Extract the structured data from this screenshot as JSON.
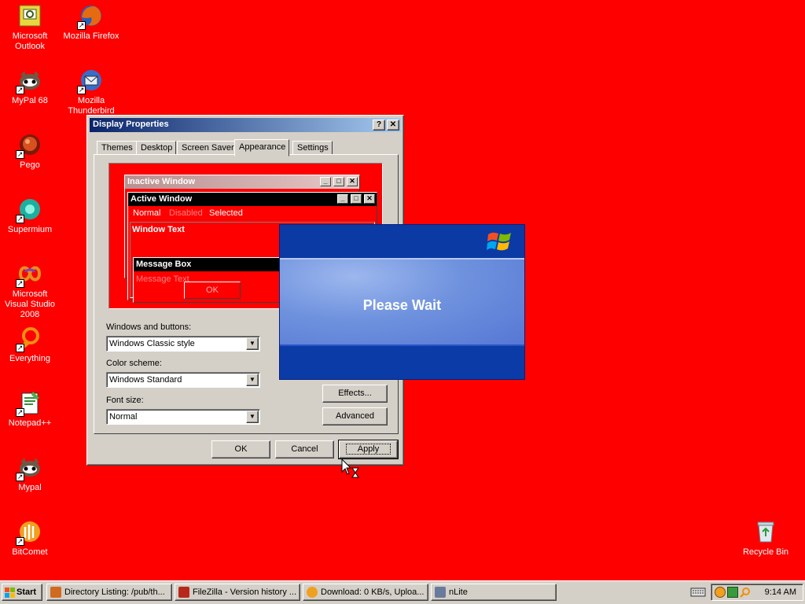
{
  "desktop": {
    "icons": [
      {
        "label": "Microsoft Outlook",
        "icon": "outlook-icon"
      },
      {
        "label": "Mozilla Firefox",
        "icon": "firefox-icon"
      },
      {
        "label": "MyPal 68",
        "icon": "mypal-icon"
      },
      {
        "label": "Mozilla Thunderbird",
        "icon": "thunderbird-icon"
      },
      {
        "label": "Pego",
        "icon": "pego-icon"
      },
      {
        "label": "Supermium",
        "icon": "supermium-icon"
      },
      {
        "label": "Microsoft Visual Studio 2008",
        "icon": "visual-studio-icon"
      },
      {
        "label": "Everything",
        "icon": "everything-icon"
      },
      {
        "label": "Notepad++",
        "icon": "notepadpp-icon"
      },
      {
        "label": "Mypal",
        "icon": "mypal-icon"
      },
      {
        "label": "BitComet",
        "icon": "bitcomet-icon"
      },
      {
        "label": "Recycle Bin",
        "icon": "recycle-bin-icon"
      }
    ]
  },
  "dialog": {
    "title": "Display Properties",
    "help_btn": "?",
    "close_btn": "✕",
    "tabs": [
      "Themes",
      "Desktop",
      "Screen Saver",
      "Appearance",
      "Settings"
    ],
    "active_tab": "Appearance",
    "preview": {
      "inactive_title": "Inactive Window",
      "active_title": "Active Window",
      "menu_normal": "Normal",
      "menu_disabled": "Disabled",
      "menu_selected": "Selected",
      "window_text": "Window Text",
      "msgbox_title": "Message Box",
      "msgbox_text": "Message Text",
      "msgbox_ok": "OK"
    },
    "windows_buttons_label": "Windows and buttons:",
    "windows_buttons_value": "Windows Classic style",
    "color_scheme_label": "Color scheme:",
    "color_scheme_value": "Windows Standard",
    "font_size_label": "Font size:",
    "font_size_value": "Normal",
    "effects_btn": "Effects...",
    "advanced_btn": "Advanced",
    "ok_btn": "OK",
    "cancel_btn": "Cancel",
    "apply_btn": "Apply"
  },
  "wait": {
    "message": "Please Wait"
  },
  "taskbar": {
    "start": "Start",
    "tasks": [
      "Directory Listing: /pub/th...",
      "FileZilla - Version history ...",
      "Download: 0 KB/s, Uploa...",
      "nLite"
    ],
    "clock": "9:14 AM"
  },
  "colors": {
    "desktop": "#ff0000",
    "face": "#d4d0c8",
    "title_active": "#0a246a",
    "xp_blue": "#0b3ba6"
  }
}
